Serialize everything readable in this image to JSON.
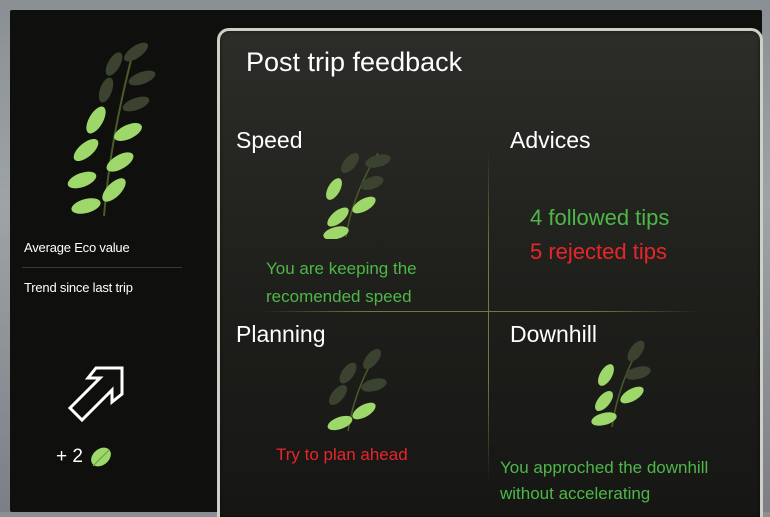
{
  "sidebar": {
    "average_label": "Average Eco value",
    "trend_label": "Trend since last trip",
    "trend_value": "+ 2",
    "icons": [
      "large-leaf-branch-icon",
      "trend-arrow-up-right-icon",
      "small-leaf-icon"
    ]
  },
  "panel": {
    "title": "Post trip feedback",
    "speed": {
      "title": "Speed",
      "message_line1": "You are keeping the",
      "message_line2": "recomended speed"
    },
    "advices": {
      "title": "Advices",
      "followed": "4 followed tips",
      "rejected": "5 rejected tips"
    },
    "planning": {
      "title": "Planning",
      "message": "Try to plan ahead"
    },
    "downhill": {
      "title": "Downhill",
      "message_line1": "You approched the downhill",
      "message_line2": "without accelerating"
    }
  },
  "colors": {
    "positive": "#4db848",
    "negative": "#e8262a",
    "leaf_lit": "#9fd86a",
    "leaf_dim": "#3d4530"
  }
}
